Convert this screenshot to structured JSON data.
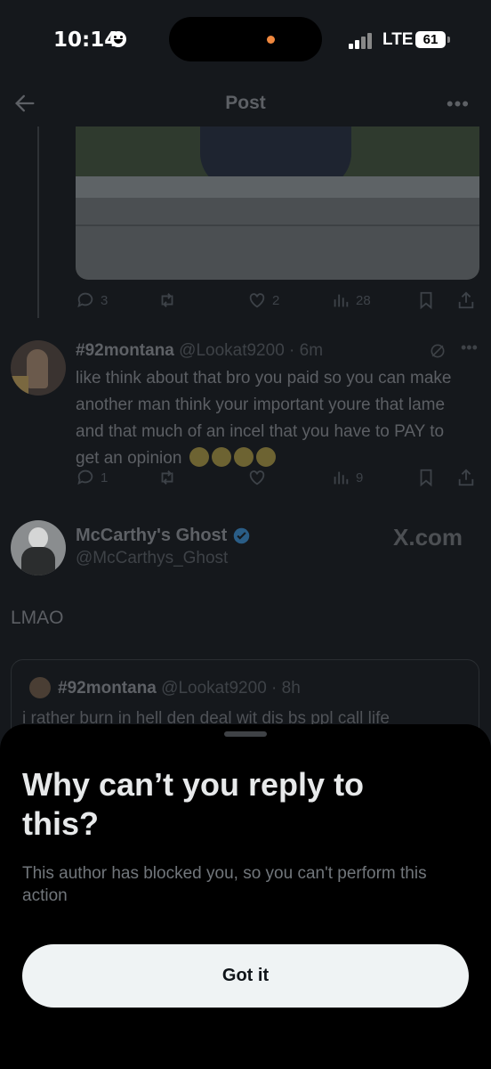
{
  "status_bar": {
    "time": "10:14",
    "network": "LTE",
    "battery": "61"
  },
  "header": {
    "title": "Post"
  },
  "media_post_stats": {
    "replies": "3",
    "retweets": "",
    "likes": "2",
    "views": "28"
  },
  "reply_tweet": {
    "display_name": "#92montana",
    "handle": "@Lookat9200",
    "age": "6m",
    "text": "like think about that bro you paid so you can make another man think your important youre that lame and that much of an incel that you have to PAY to get an opinion",
    "stats": {
      "replies": "1",
      "retweets": "",
      "likes": "",
      "views": "9"
    }
  },
  "main_tweet": {
    "display_name": "McCarthy's Ghost",
    "handle": "@McCarthys_Ghost",
    "watermark": "X.com",
    "text": "LMAO"
  },
  "quoted_tweet": {
    "display_name": "#92montana",
    "handle": "@Lookat9200",
    "age": "8h",
    "text": "i rather burn in hell den deal wit dis bs ppl call life"
  },
  "sheet": {
    "title": "Why can’t you reply to this?",
    "description": "This author has blocked you, so you can't perform this action",
    "button_label": "Got it"
  },
  "colors": {
    "sheet_bg": "#000000",
    "button_bg": "#eff3f4",
    "verified": "#1d9bf0"
  }
}
